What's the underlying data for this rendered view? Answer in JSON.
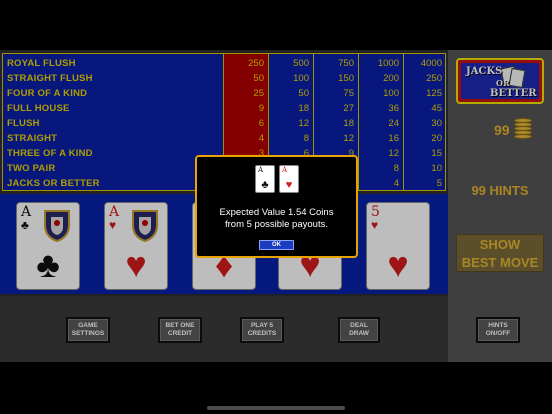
{
  "paytable": {
    "hands": [
      "ROYAL FLUSH",
      "STRAIGHT FLUSH",
      "FOUR OF A KIND",
      "FULL HOUSE",
      "FLUSH",
      "STRAIGHT",
      "THREE OF A KIND",
      "TWO PAIR",
      "JACKS OR BETTER"
    ],
    "columns": [
      {
        "values": [
          "250",
          "50",
          "25",
          "9",
          "6",
          "4",
          "3",
          "2",
          "1"
        ],
        "active": true
      },
      {
        "values": [
          "500",
          "100",
          "50",
          "18",
          "12",
          "8",
          "6",
          "4",
          "2"
        ],
        "active": false
      },
      {
        "values": [
          "750",
          "150",
          "75",
          "27",
          "18",
          "12",
          "9",
          "6",
          "3"
        ],
        "active": false
      },
      {
        "values": [
          "1000",
          "200",
          "100",
          "36",
          "24",
          "16",
          "12",
          "8",
          "4"
        ],
        "active": false
      },
      {
        "values": [
          "4000",
          "250",
          "125",
          "45",
          "30",
          "20",
          "15",
          "10",
          "5"
        ],
        "active": false
      }
    ]
  },
  "logo": {
    "line1": "JACKS",
    "line2": "OR",
    "line3": "BETTER"
  },
  "coins": "99",
  "hints_label": "99 HINTS",
  "show_best_move": {
    "line1": "SHOW",
    "line2": "BEST MOVE"
  },
  "cards": [
    {
      "rank": "A",
      "suit": "♣",
      "color": "black",
      "face": "crest"
    },
    {
      "rank": "A",
      "suit": "♥",
      "color": "red",
      "face": "crest"
    },
    {
      "rank": "",
      "suit": "♦",
      "color": "red",
      "face": "pip"
    },
    {
      "rank": "",
      "suit": "♥",
      "color": "red",
      "face": "pip"
    },
    {
      "rank": "5",
      "suit": "♥",
      "color": "red",
      "face": "pip"
    }
  ],
  "buttons": {
    "game_settings": {
      "line1": "GAME",
      "line2": "SETTINGS"
    },
    "bet_one": {
      "line1": "BET ONE",
      "line2": "CREDIT"
    },
    "play_5": {
      "line1": "PLAY 5",
      "line2": "CREDITS"
    },
    "deal_draw": {
      "line1": "DEAL",
      "line2": "DRAW"
    },
    "hints": {
      "line1": "HINTS",
      "line2": "ON/OFF"
    }
  },
  "dialog": {
    "cards": [
      {
        "rank": "A",
        "suit": "♣",
        "color": "black"
      },
      {
        "rank": "A",
        "suit": "♥",
        "color": "red"
      }
    ],
    "line1": "Expected Value 1.54 Coins",
    "line2": "from 5 possible payouts.",
    "ok_label": "OK"
  }
}
